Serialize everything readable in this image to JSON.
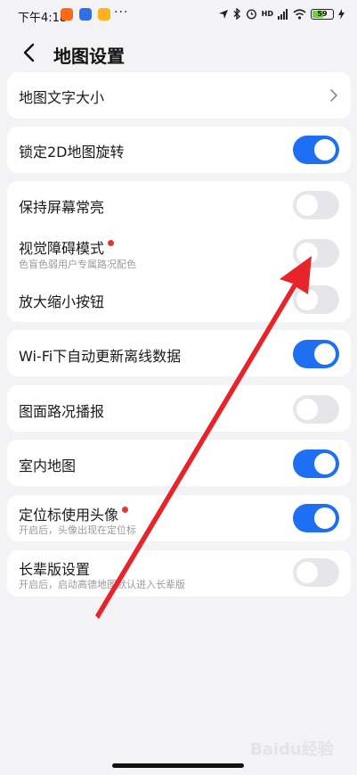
{
  "status_bar": {
    "time": "下午4:18",
    "dots": "···",
    "signal_text": "HD",
    "battery": "59",
    "battery_level": 0.59
  },
  "header": {
    "title": "地图设置"
  },
  "settings": {
    "font_size": {
      "label": "地图文字大小"
    },
    "lock_2d": {
      "label": "锁定2D地图旋转",
      "on": true
    },
    "keep_screen_on": {
      "label": "保持屏幕常亮",
      "on": false
    },
    "visual_mode": {
      "label": "视觉障碍模式",
      "sub": "色盲色弱用户专属路况配色",
      "on": false
    },
    "zoom_buttons": {
      "label": "放大缩小按钮",
      "on": false
    },
    "wifi_update": {
      "label": "Wi-Fi下自动更新离线数据",
      "on": true
    },
    "traffic_broadcast": {
      "label": "图面路况播报",
      "on": false
    },
    "indoor_map": {
      "label": "室内地图",
      "on": true
    },
    "avatar_marker": {
      "label": "定位标使用头像",
      "sub": "开启后，头像出现在定位标",
      "on": true
    },
    "elder_mode": {
      "label": "长辈版设置",
      "sub": "开启后，启动高德地图默认进入长辈版",
      "on": false
    }
  },
  "colors": {
    "accent": "#1f6ff2",
    "toggle_off": "#e6e6ea",
    "new_dot": "#e7362f",
    "annotation_arrow": "#e8242a"
  },
  "watermark": "Baidu经验"
}
